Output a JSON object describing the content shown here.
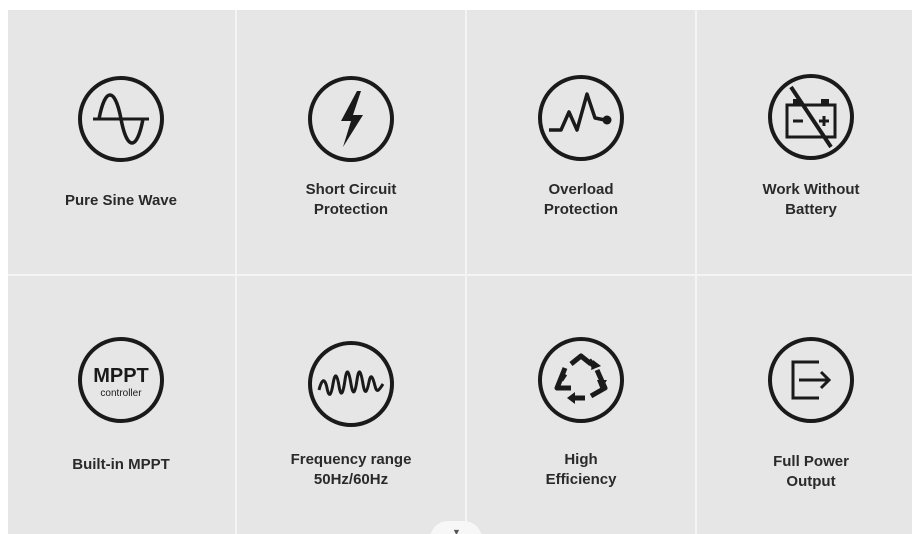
{
  "features": [
    {
      "label": "Pure Sine Wave",
      "icon": "sine-wave-icon"
    },
    {
      "label": "Short Circuit\nProtection",
      "icon": "lightning-bolt-icon"
    },
    {
      "label": "Overload\nProtection",
      "icon": "heartbeat-pulse-icon"
    },
    {
      "label": "Work Without\nBattery",
      "icon": "no-battery-icon"
    },
    {
      "label": "Built-in MPPT",
      "icon": "mppt-controller-icon",
      "icon_text": "MPPT",
      "icon_subtext": "controller"
    },
    {
      "label": "Frequency range\n50Hz/60Hz",
      "icon": "frequency-wave-icon"
    },
    {
      "label": "High\nEfficiency",
      "icon": "recycle-arrows-icon"
    },
    {
      "label": "Full Power\nOutput",
      "icon": "power-output-icon"
    }
  ],
  "colors": {
    "background": "#e6e6e6",
    "icon_stroke": "#1a1a1a",
    "text": "#2a2a2a",
    "divider": "#f4f4f4"
  }
}
